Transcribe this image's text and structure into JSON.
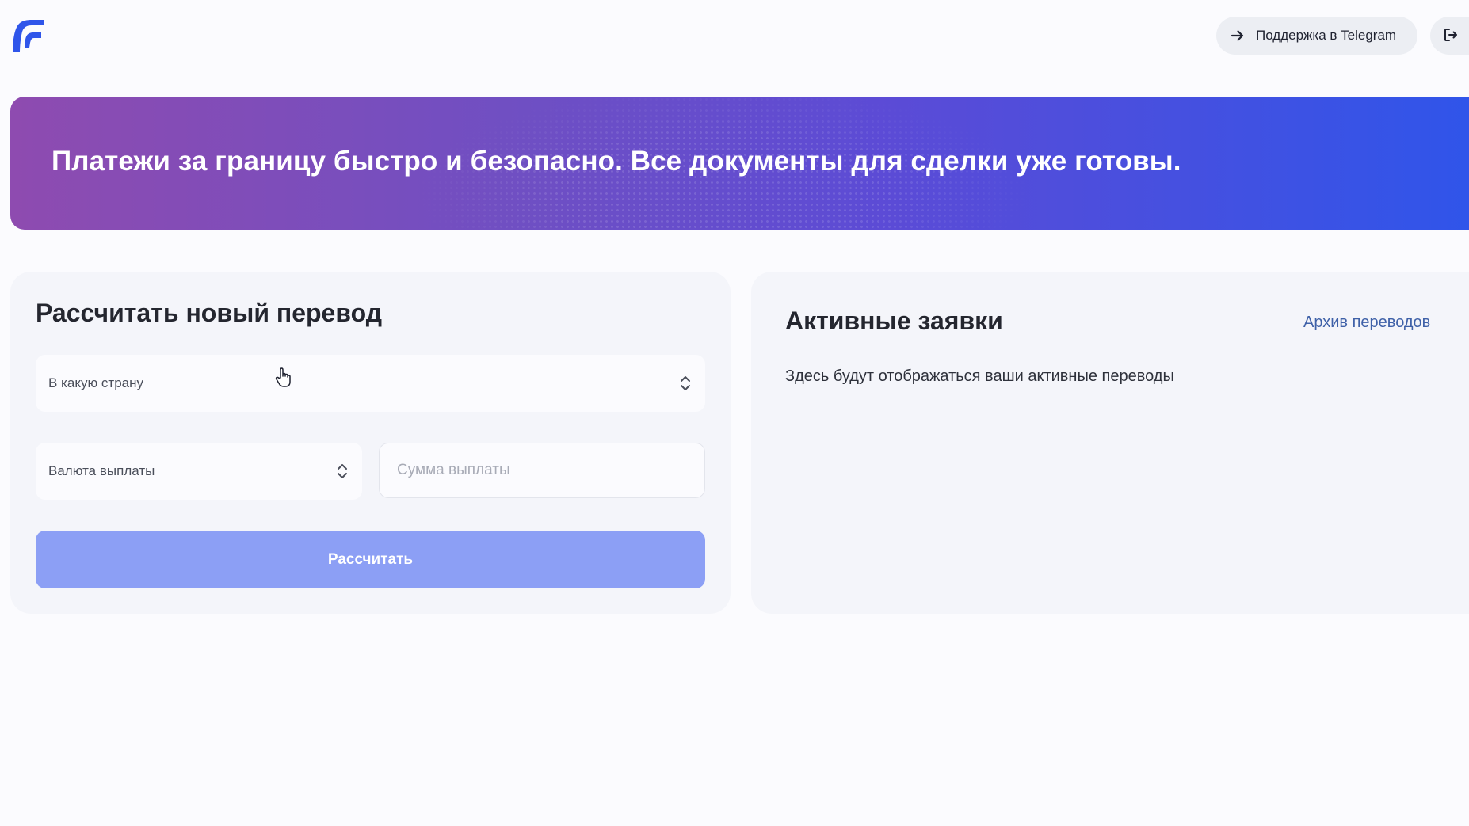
{
  "header": {
    "logo_icon": "brand-logo-icon",
    "support_label": "Поддержка в Telegram",
    "support_icon": "arrow-right-icon",
    "logout_icon": "logout-icon"
  },
  "banner": {
    "title": "Платежи за границу быстро и безопасно. Все документы для сделки уже готовы."
  },
  "calculator": {
    "title": "Рассчитать новый перевод",
    "country_select": "В какую страну",
    "currency_select": "Валюта выплаты",
    "amount_placeholder": "Сумма выплаты",
    "amount_value": "",
    "submit_label": "Рассчитать"
  },
  "active": {
    "title": "Активные заявки",
    "archive_link": "Архив переводов",
    "empty_message": "Здесь будут отображаться ваши активные переводы"
  },
  "colors": {
    "accent": "#2f55ea",
    "button_disabled": "#8c9ff5",
    "link": "#3f61a8",
    "banner_start": "#8e4bb0",
    "banner_end": "#2f55ea"
  }
}
